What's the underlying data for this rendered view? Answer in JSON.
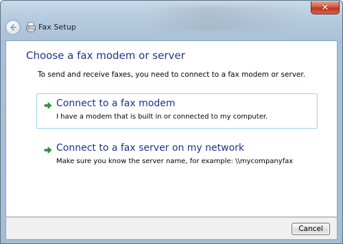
{
  "window": {
    "title": "Fax Setup",
    "close_glyph": "✕",
    "colors": {
      "frame": "#a9c1d8",
      "heading": "#1e3287",
      "close": "#c7412a",
      "arrow": "#2f9a3c",
      "hover_border": "#a6d8f2"
    }
  },
  "icons": {
    "back": "back-arrow-icon",
    "title": "fax-printer-icon",
    "option_arrow": "green-arrow-icon"
  },
  "page": {
    "heading": "Choose a fax modem or server",
    "instruction": "To send and receive faxes, you need to connect to a fax modem or server."
  },
  "options": [
    {
      "title": "Connect to a fax modem",
      "description": "I have a modem that is built in or connected to my computer."
    },
    {
      "title": "Connect to a fax server on my network",
      "description": "Make sure you know the server name, for example: \\\\mycompanyfax"
    }
  ],
  "footer": {
    "cancel_label": "Cancel"
  }
}
